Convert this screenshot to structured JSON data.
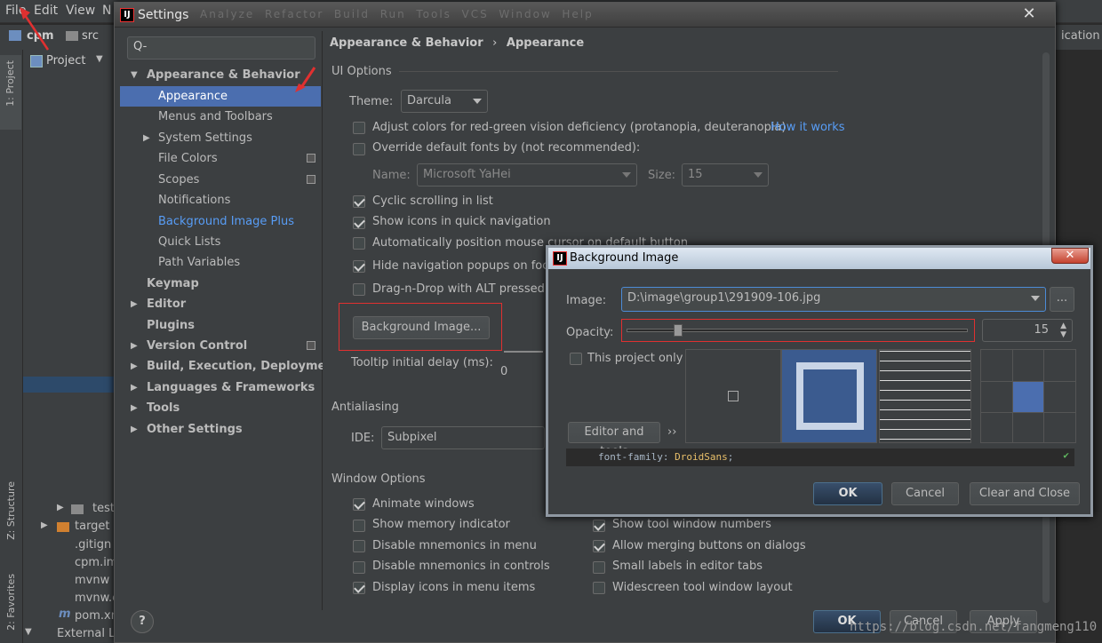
{
  "ide": {
    "menu": [
      "File",
      "Edit",
      "View",
      "N"
    ],
    "nav": {
      "project": "cpm",
      "folder": "src",
      "configuration": "ication"
    },
    "project_dropdown": "Project",
    "left_tabs": [
      "1: Project",
      "Z: Structure",
      "2: Favorites"
    ],
    "tree": [
      {
        "label": "test"
      },
      {
        "label": "target"
      },
      {
        "label": ".gitign"
      },
      {
        "label": "cpm.im"
      },
      {
        "label": "mvnw"
      },
      {
        "label": "mvnw.c"
      },
      {
        "label": "pom.xm"
      },
      {
        "label": "External Li"
      }
    ],
    "menu_dim": [
      "Analyze",
      "Refactor",
      "Build",
      "Run",
      "Tools",
      "VCS",
      "Window",
      "Help"
    ]
  },
  "settings": {
    "title": "Settings",
    "search_placeholder": "Q-",
    "breadcrumb": {
      "parent": "Appearance & Behavior",
      "sep": "›",
      "current": "Appearance"
    },
    "nav": [
      {
        "label": "Appearance & Behavior",
        "bold": true,
        "expanded": true
      },
      {
        "label": "Appearance",
        "selected": true
      },
      {
        "label": "Menus and Toolbars"
      },
      {
        "label": "System Settings"
      },
      {
        "label": "File Colors"
      },
      {
        "label": "Scopes"
      },
      {
        "label": "Notifications"
      },
      {
        "label": "Background Image Plus",
        "link": true
      },
      {
        "label": "Quick Lists"
      },
      {
        "label": "Path Variables"
      },
      {
        "label": "Keymap",
        "bold": true
      },
      {
        "label": "Editor",
        "bold": true
      },
      {
        "label": "Plugins",
        "bold": true
      },
      {
        "label": "Version Control",
        "bold": true
      },
      {
        "label": "Build, Execution, Deployment",
        "bold": true
      },
      {
        "label": "Languages & Frameworks",
        "bold": true
      },
      {
        "label": "Tools",
        "bold": true
      },
      {
        "label": "Other Settings",
        "bold": true
      }
    ],
    "ui_options": {
      "title": "UI Options",
      "theme_label": "Theme:",
      "theme_value": "Darcula",
      "adjust_colors": "Adjust colors for red-green vision deficiency (protanopia, deuteranopia)",
      "how_it_works": "How it works",
      "override_fonts": "Override default fonts by (not recommended):",
      "name_label": "Name:",
      "name_value": "Microsoft YaHei",
      "size_label": "Size:",
      "size_value": "15",
      "cyclic": "Cyclic scrolling in list",
      "show_icons": "Show icons in quick navigation",
      "auto_position": "Automatically position mouse cursor on default button",
      "hide_nav": "Hide navigation popups on focu",
      "drag_drop": "Drag-n-Drop with ALT pressed o",
      "bg_button": "Background Image...",
      "tooltip_label": "Tooltip initial delay (ms):",
      "tooltip_value": "0"
    },
    "antialiasing": {
      "title": "Antialiasing",
      "ide_label": "IDE:",
      "ide_value": "Subpixel"
    },
    "window_options": {
      "title": "Window Options",
      "animate": "Animate windows",
      "memory": "Show memory indicator",
      "disable_mnemonics_menu": "Disable mnemonics in menu",
      "disable_mnemonics_controls": "Disable mnemonics in controls",
      "display_icons": "Display icons in menu items",
      "show_tool_numbers": "Show tool window numbers",
      "allow_merging": "Allow merging buttons on dialogs",
      "small_labels": "Small labels in editor tabs",
      "widescreen": "Widescreen tool window layout"
    },
    "footer": {
      "ok": "OK",
      "cancel": "Cancel",
      "apply": "Apply",
      "help": "?"
    }
  },
  "bg_dialog": {
    "title": "Background Image",
    "image_label": "Image:",
    "image_value": "D:\\image\\group1\\291909-106.jpg",
    "browse": "...",
    "opacity_label": "Opacity:",
    "opacity_value": "15",
    "opacity_fraction": 0.15,
    "this_project_only": "This project only",
    "editor_and_tools": "Editor and tools",
    "more": "››",
    "code_prefix": "font-family: ",
    "code_value": "DroidSans",
    "code_suffix": ";",
    "ok": "OK",
    "cancel": "Cancel",
    "clear_close": "Clear and Close"
  },
  "watermark": "https://blog.csdn.net/fangmeng110",
  "colors": {
    "selection": "#4b6eaf",
    "link": "#589df6",
    "annotation_red": "#e03030",
    "dialog_bg": "#3c3f41"
  }
}
